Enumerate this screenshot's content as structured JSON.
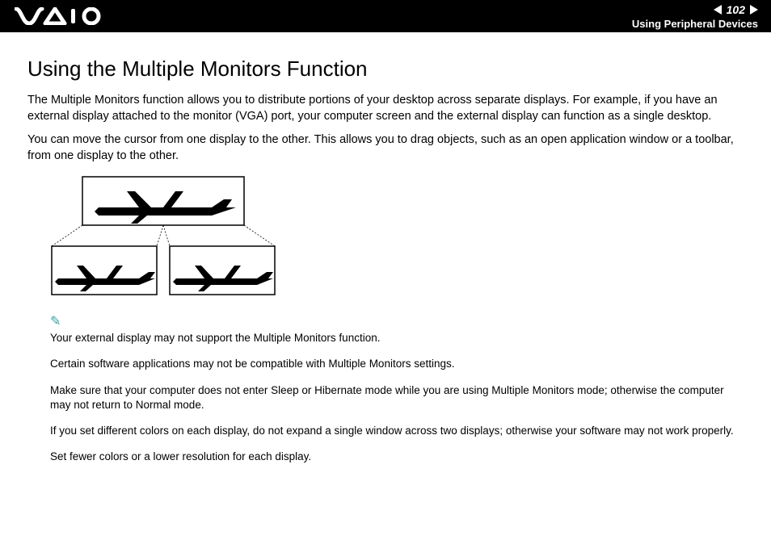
{
  "header": {
    "page_number": "102",
    "section": "Using Peripheral Devices"
  },
  "body": {
    "title": "Using the Multiple Monitors Function",
    "para1": "The Multiple Monitors function allows you to distribute portions of your desktop across separate displays. For example, if you have an external display attached to the monitor (VGA) port, your computer screen and the external display can function as a single desktop.",
    "para2": "You can move the cursor from one display to the other. This allows you to drag objects, such as an open application window or a toolbar, from one display to the other."
  },
  "notes": {
    "n1": "Your external display may not support the Multiple Monitors function.",
    "n2": "Certain software applications may not be compatible with Multiple Monitors settings.",
    "n3": "Make sure that your computer does not enter Sleep or Hibernate mode while you are using Multiple Monitors mode; otherwise the computer may not return to Normal mode.",
    "n4": "If you set different colors on each display, do not expand a single window across two displays; otherwise your software may not work properly.",
    "n5": "Set fewer colors or a lower resolution for each display."
  }
}
